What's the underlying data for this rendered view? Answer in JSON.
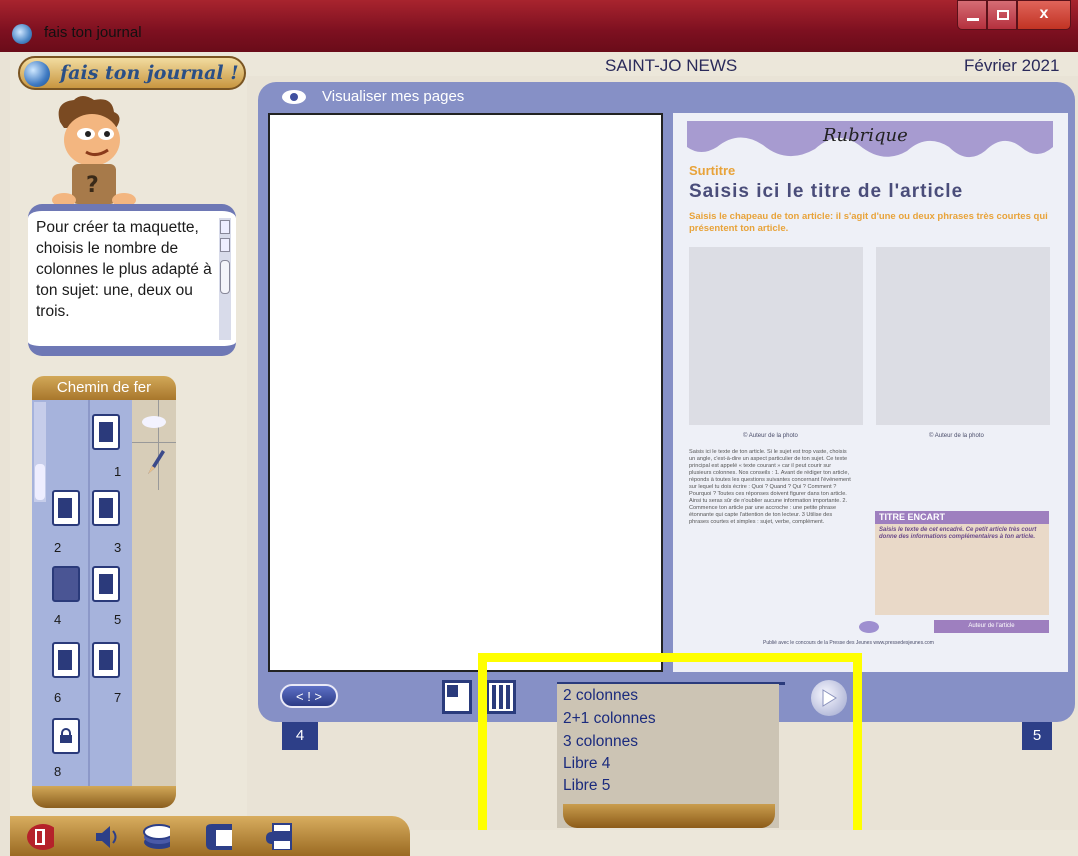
{
  "window": {
    "title": "fais ton journal",
    "close_label": "x"
  },
  "app": {
    "logo_text": "fais ton journal !",
    "journal_name": "SAINT-JO NEWS",
    "date": "Février 2021"
  },
  "help": {
    "text": "Pour créer ta maquette, choisis le nombre de colonnes le plus adapté à ton sujet: une, deux ou trois."
  },
  "chemin_de_fer": {
    "title": "Chemin de fer",
    "pages": [
      "1",
      "2",
      "3",
      "4",
      "5",
      "6",
      "7",
      "8"
    ]
  },
  "viewer": {
    "label": "Visualiser mes pages",
    "nav_label": "< ! >",
    "left_page_number": "4",
    "right_page_number": "5"
  },
  "article": {
    "rubrique": "Rubrique",
    "surtitre": "Surtitre",
    "titre": "Saisis ici le titre de l'article",
    "chapeau": "Saisis le chapeau de ton article: il s'agit d'une ou deux phrases très courtes qui présentent ton article.",
    "credit1": "© Auteur de la photo",
    "credit2": "© Auteur de la photo",
    "body": "Saisis ici le texte de ton article. Si le sujet est trop vaste, choisis un angle, c'est-à-dire un aspect particulier de ton sujet. Ce texte principal est appelé « texte courant » car il peut courir sur plusieurs colonnes. Nos conseils : 1. Avant de rédiger ton article, réponds à toutes les questions suivantes concernant l'événement sur lequel tu dois écrire : Quoi ? Quand ? Qui ? Comment ? Pourquoi ? Toutes ces réponses doivent figurer dans ton article. Ainsi tu seras sûr de n'oublier aucune information importante. 2. Commence ton article par une accroche : une petite phrase étonnante qui capte l'attention de ton lecteur. 3 Utilise des phrases courtes et simples : sujet, verbe, complément.",
    "encart_titre": "TITRE ENCART",
    "encart_texte": "Saisis le texte de cet encadré. Ce petit article très court donne des informations complémentaires à ton article.",
    "auteur": "Auteur de l'article",
    "footer": "Publié avec le concours de la Presse des Jeunes   www.pressedesjeunes.com"
  },
  "dropdown": {
    "options": [
      "2 colonnes",
      "2+1 colonnes",
      "3 colonnes",
      "Libre 4",
      "Libre 5"
    ]
  },
  "colors": {
    "frame": "#8690c6",
    "dark_blue": "#2d3f88",
    "gold": "#c89640",
    "highlight": "#ffff00",
    "rubrique_purple": "#a79bd0",
    "surtitre_orange": "#e8a33a"
  }
}
